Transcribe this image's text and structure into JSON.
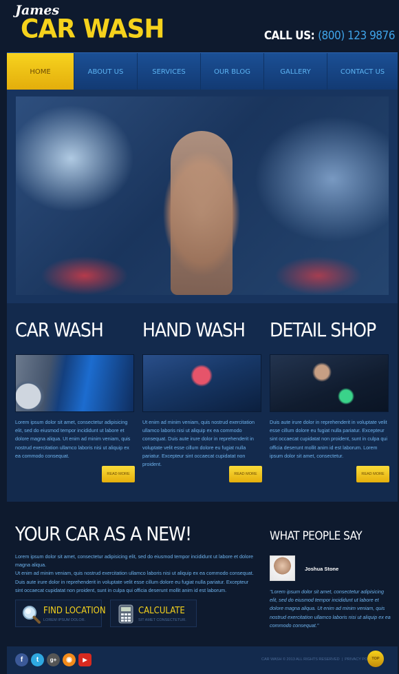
{
  "header": {
    "logo_script": "James",
    "logo_main": "CAR WASH",
    "call_label": "CALL US:",
    "phone": "(800) 123 9876"
  },
  "nav": {
    "items": [
      {
        "label": "HOME",
        "active": true
      },
      {
        "label": "ABOUT US",
        "active": false
      },
      {
        "label": "SERVICES",
        "active": false
      },
      {
        "label": "OUR BLOG",
        "active": false
      },
      {
        "label": "GALLERY",
        "active": false
      },
      {
        "label": "CONTACT US",
        "active": false
      }
    ]
  },
  "features": [
    {
      "title": "CAR WASH",
      "text": "Lorem ipsum dolor sit amet, consectetur adipisicing elit, sed do eiusmod tempor incididunt ut labore et dolore magna aliqua. Ut enim ad minim veniam, quis nostrud exercitation ullamco laboris nisi ut aliquip ex ea commodo consequat.",
      "button": "READ MORE"
    },
    {
      "title": "HAND WASH",
      "text": "Ut enim ad minim veniam, quis nostrud exercitation ullamco laboris nisi ut aliquip ex ea commodo consequat. Duis aute irure dolor in reprehenderit in voluptate velit esse cillum dolore eu fugiat nulla pariatur. Excepteur sint occaecat cupidatat non proident.",
      "button": "READ MORE"
    },
    {
      "title": "DETAIL SHOP",
      "text": "Duis aute irure dolor in reprehenderit in voluptate velit esse cillum dolore eu fugiat nulla pariatur. Excepteur sint occaecat cupidatat non proident, sunt in culpa qui officia deserunt mollit anim id est laborum. Lorem ipsum dolor sit amet, consectetur.",
      "button": "READ MORE"
    }
  ],
  "lower": {
    "title": "YOUR CAR AS A NEW!",
    "text": "Lorem ipsum dolor sit amet, consectetur adipisicing elit, sed do eiusmod tempor incididunt ut labore et dolore magna aliqua.\nUt enim ad minim veniam, quis nostrud exercitation ullamco laboris nisi ut aliquip ex ea commodo consequat. Duis aute irure dolor in reprehenderit in voluptate velit esse cillum dolore eu fugiat nulla pariatur. Excepteur sint occaecat cupidatat non proident, sunt in culpa qui officia deserunt mollit anim id est laborum.",
    "actions": [
      {
        "title": "FIND LOCATION",
        "sub": "LOREM IPSUM DOLOR.",
        "icon": "magnifier-icon"
      },
      {
        "title": "CALCULATE",
        "sub": "SIT AMET CONSECTETUR.",
        "icon": "calculator-icon"
      }
    ]
  },
  "testimonial": {
    "title": "WHAT PEOPLE SAY",
    "author": "Joshua Stone",
    "quote": "\"Lorem ipsum dolor sit amet, consectetur adipisicing elit, sed do eiusmod tempor incididunt ut labore et dolore magna aliqua. Ut enim ad minim veniam, quis nostrud exercitation ullamco laboris nisi ut aliquip ex ea commodo consequat.\""
  },
  "footer": {
    "social": [
      {
        "icon": "facebook-icon",
        "glyph": "f",
        "color": "#3b5998"
      },
      {
        "icon": "twitter-icon",
        "glyph": "t",
        "color": "#2fa8e0"
      },
      {
        "icon": "google-plus-icon",
        "glyph": "g+",
        "color": "#555555"
      },
      {
        "icon": "rss-icon",
        "glyph": "◉",
        "color": "#f28a1a"
      },
      {
        "icon": "youtube-icon",
        "glyph": "▶",
        "color": "#d82a1f"
      }
    ],
    "copyright": "CAR WASH © 2013 ALL RIGHTS RESERVED  |  PRIVACY POLICY",
    "top_label": "TOP"
  },
  "colors": {
    "accent_yellow": "#f5d21c",
    "link_blue": "#3fa3e8",
    "background": "#0e1a2e"
  }
}
